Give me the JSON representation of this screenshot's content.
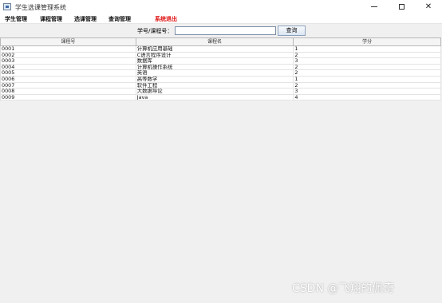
{
  "window": {
    "title": "学生选课管理系统",
    "controls": {
      "minimize_icon": "minimize-icon",
      "maximize_icon": "maximize-icon",
      "close_icon": "close-icon",
      "close_glyph": "✕"
    }
  },
  "menubar": {
    "items": [
      "学生管理",
      "课程管理",
      "选课管理",
      "查询管理"
    ],
    "exit_label": "系统退出",
    "exit_color": "#e01010"
  },
  "search": {
    "label": "学号/课程号：",
    "value": "",
    "button_label": "查询"
  },
  "table": {
    "headers": [
      "课程号",
      "课程名",
      "学分"
    ],
    "rows": [
      [
        "0001",
        "计算机应用基础",
        "1"
      ],
      [
        "0002",
        "C语言程序设计",
        "2"
      ],
      [
        "0003",
        "数据库",
        "3"
      ],
      [
        "0004",
        "计算机操作系统",
        "2"
      ],
      [
        "0005",
        "英语",
        "2"
      ],
      [
        "0006",
        "高等数学",
        "1"
      ],
      [
        "0007",
        "软件工程",
        "2"
      ],
      [
        "0008",
        "大数据导论",
        "3"
      ],
      [
        "0009",
        "Java",
        "4"
      ]
    ]
  },
  "watermark": "CSDN @飞翔的佩奇"
}
